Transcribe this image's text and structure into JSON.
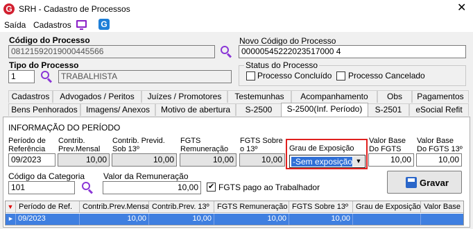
{
  "window": {
    "title": "SRH - Cadastro de Processos",
    "close": "✕"
  },
  "menu": {
    "items": [
      "Saída",
      "Cadastros"
    ]
  },
  "form": {
    "codigo_processo_label": "Código do Processo",
    "codigo_processo_value": "08121592019000445566",
    "novo_codigo_label": "Novo Código do Processo",
    "novo_codigo_value": "00000545222023517000 4",
    "tipo_processo_label": "Tipo do Processo",
    "tipo_processo_code": "1",
    "tipo_processo_desc": "TRABALHISTA",
    "status_label": "Status do Processo",
    "status_concluido": "Processo Concluído",
    "status_cancelado": "Processo Cancelado"
  },
  "tabs_row1": [
    "Cadastros",
    "Advogados / Peritos",
    "Juízes / Promotores",
    "Testemunhas",
    "Acompanhamento",
    "Obs",
    "Pagamentos"
  ],
  "tabs_row2": [
    "Bens Penhorados",
    "Imagens/ Anexos",
    "Motivo de abertura",
    "S-2500",
    "S-2500(Inf. Período)",
    "S-2501",
    "eSocial Refit"
  ],
  "active_tab": "S-2500(Inf. Período)",
  "periodo": {
    "section_title": "INFORMAÇÃO DO PERÍODO",
    "periodo_ref_label": "Período de Referência",
    "periodo_ref_value": "09/2023",
    "contrib_prev_mensal_label": "Contrib. Prev.Mensal",
    "contrib_prev_mensal_value": "10,00",
    "contrib_prev_13_label": "Contrib. Previd. Sob 13º",
    "contrib_prev_13_value": "10,00",
    "fgts_rem_label": "FGTS Remuneração",
    "fgts_rem_value": "10,00",
    "fgts_13_label": "FGTS Sobre o 13º",
    "fgts_13_value": "10,00",
    "grau_exposicao_label": "Grau de Exposição",
    "grau_exposicao_value": "-Sem exposição a",
    "valor_base_fgts_label": "Valor Base Do FGTS",
    "valor_base_fgts_value": "10,00",
    "valor_base_fgts13_label": "Valor Base Do FGTS 13º",
    "valor_base_fgts13_value": "10,00",
    "codigo_categoria_label": "Código da Categoria",
    "codigo_categoria_value": "101",
    "valor_remuneracao_label": "Valor da Remuneração",
    "valor_remuneracao_value": "10,00",
    "fgts_pago_label": "FGTS pago ao Trabalhador",
    "fgts_pago_checked": true,
    "gravar_label": "Gravar"
  },
  "grid": {
    "columns": [
      "Período de Ref.",
      "Contrib.Prev.Mensal",
      "Contrib.Prev. 13º",
      "FGTS Remuneração",
      "FGTS Sobre 13º",
      "Grau de Exposição",
      "Valor Base"
    ],
    "rows": [
      [
        "09/2023",
        "10,00",
        "10,00",
        "10,00",
        "10,00",
        "",
        ""
      ]
    ]
  }
}
